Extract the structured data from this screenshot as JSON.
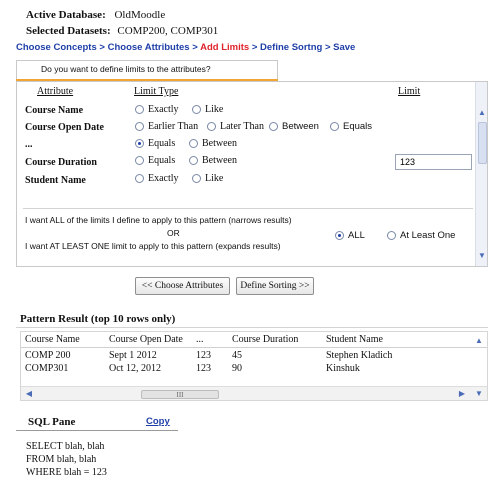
{
  "header": {
    "db_label": "Active Database:",
    "db_value": "OldMoodle",
    "ds_label": "Selected Datasets:",
    "ds_value": "COMP200, COMP301"
  },
  "breadcrumbs": [
    {
      "label": "Choose Concepts",
      "state": "link"
    },
    {
      "label": "Choose Attributes",
      "state": "link"
    },
    {
      "label": "Add Limits",
      "state": "active"
    },
    {
      "label": "Define Sortng",
      "state": "link"
    },
    {
      "label": "Save",
      "state": "link"
    }
  ],
  "limits": {
    "tab_label": "Do you want to define limits to the attributes?",
    "col_attribute": "Attribute",
    "col_limit_type": "Limit Type",
    "col_limit": "Limit",
    "rows": [
      {
        "name": "Course Name",
        "options": [
          "Exactly",
          "Like"
        ],
        "selected": -1
      },
      {
        "name": "Course Open Date",
        "options": [
          "Earlier Than",
          "Later Than",
          "Between",
          "Equals"
        ],
        "selected": -1
      },
      {
        "name": "...",
        "options": [
          "Equals",
          "Between"
        ],
        "selected": 0,
        "limit_value": "123"
      },
      {
        "name": "Course Duration",
        "options": [
          "Equals",
          "Between"
        ],
        "selected": -1
      },
      {
        "name": "Student Name",
        "options": [
          "Exactly",
          "Like"
        ],
        "selected": -1
      }
    ],
    "all_text": "I want ALL of the limits I define to apply to this pattern (narrows results)",
    "or_text": "OR",
    "atleast_text": "I want AT LEAST ONE limit to apply to this pattern (expands results)",
    "match_all_label": "ALL",
    "match_one_label": "At Least One",
    "match_selected": "all"
  },
  "buttons": {
    "choose_attributes": "<< Choose Attributes",
    "define_sorting": "Define Sorting >>"
  },
  "results": {
    "title": "Pattern Result (top 10 rows only)",
    "columns": [
      "Course Name",
      "Course Open Date",
      "...",
      "Course Duration",
      "Student Name"
    ],
    "rows": [
      [
        "COMP 200",
        "Sept 1 2012",
        "123",
        "45",
        "Stephen Kladich"
      ],
      [
        "COMP301",
        "Oct 12, 2012",
        "123",
        "90",
        "Kinshuk"
      ]
    ],
    "hscroll_thumb": "III"
  },
  "sql": {
    "title": "SQL Pane",
    "copy_label": "Copy",
    "lines": [
      "SELECT blah, blah",
      "FROM blah, blah",
      "WHERE blah = 123"
    ]
  },
  "icons": {
    "scroll_up": "chevron-up-icon",
    "scroll_down": "chevron-down-icon",
    "scroll_left": "chevron-left-icon",
    "scroll_right": "chevron-right-icon"
  },
  "colors": {
    "link": "#1f3fa8",
    "active_step": "#e0232b",
    "tab_accent": "#f0a536"
  }
}
